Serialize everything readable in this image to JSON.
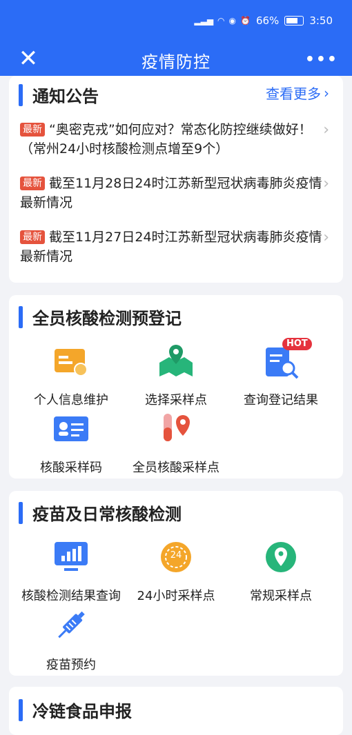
{
  "status_bar": {
    "battery": "66%",
    "time": "3:50"
  },
  "header": {
    "title": "疫情防控",
    "close_icon": "close-icon",
    "more_icon": "more-icon"
  },
  "notice": {
    "title": "通知公告",
    "more_label": "查看更多",
    "items": [
      {
        "badge": "最新",
        "text": "“奥密克戎”如何应对？常态化防控继续做好！（常州24小时核酸检测点增至9个）"
      },
      {
        "badge": "最新",
        "text": "截至11月28日24时江苏新型冠状病毒肺炎疫情最新情况"
      },
      {
        "badge": "最新",
        "text": "截至11月27日24时江苏新型冠状病毒肺炎疫情最新情况"
      }
    ]
  },
  "registration": {
    "title": "全员核酸检测预登记",
    "items": [
      {
        "label": "个人信息维护",
        "icon": "id-card-wrench-icon"
      },
      {
        "label": "选择采样点",
        "icon": "map-pin-icon"
      },
      {
        "label": "查询登记结果",
        "icon": "doc-search-icon",
        "badge": "HOT"
      },
      {
        "label": "核酸采样码",
        "icon": "id-card-icon"
      },
      {
        "label": "全员核酸采样点",
        "icon": "test-tube-pin-icon"
      }
    ]
  },
  "vaccine": {
    "title": "疫苗及日常核酸检测",
    "items": [
      {
        "label": "核酸检测结果查询",
        "icon": "monitor-chart-icon"
      },
      {
        "label": "24小时采样点",
        "icon": "clock-24-icon",
        "icon_text": "24"
      },
      {
        "label": "常规采样点",
        "icon": "location-pin-icon"
      },
      {
        "label": "疫苗预约",
        "icon": "syringe-icon"
      }
    ]
  },
  "cold_chain": {
    "title": "冷链食品申报"
  },
  "colors": {
    "primary": "#2b6cf6",
    "badge_red": "#e5533d",
    "orange": "#f4a62a",
    "green": "#27b57a"
  }
}
